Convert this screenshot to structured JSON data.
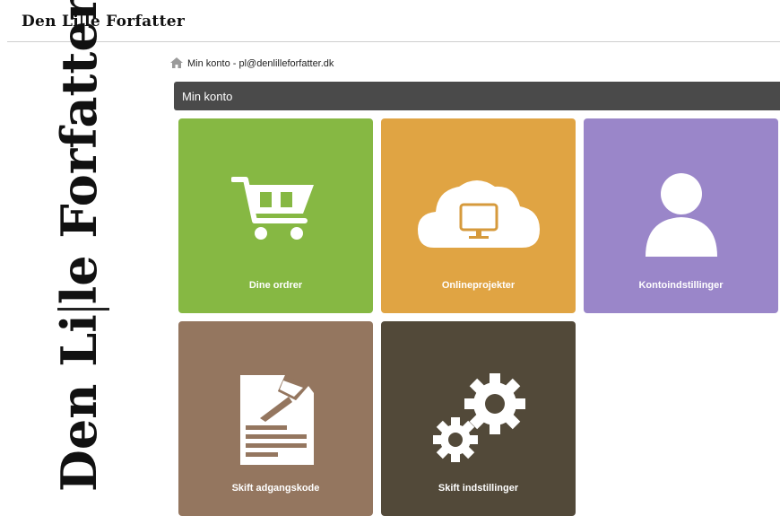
{
  "brand": {
    "name_start": "Den Li",
    "name_end": "le Forfatter"
  },
  "breadcrumb": {
    "text": "Min konto - pl@denlilleforfatter.dk"
  },
  "page": {
    "title": "Min konto"
  },
  "tiles": [
    {
      "label": "Dine ordrer",
      "icon": "shopping-cart-icon",
      "color": "#86b843"
    },
    {
      "label": "Onlineprojekter",
      "icon": "cloud-monitor-icon",
      "color": "#e0a443"
    },
    {
      "label": "Kontoindstillinger",
      "icon": "user-icon",
      "color": "#9a86c9"
    },
    {
      "label": "Skift adgangskode",
      "icon": "document-pen-icon",
      "color": "#94765f"
    },
    {
      "label": "Skift indstillinger",
      "icon": "gears-icon",
      "color": "#524939"
    }
  ]
}
